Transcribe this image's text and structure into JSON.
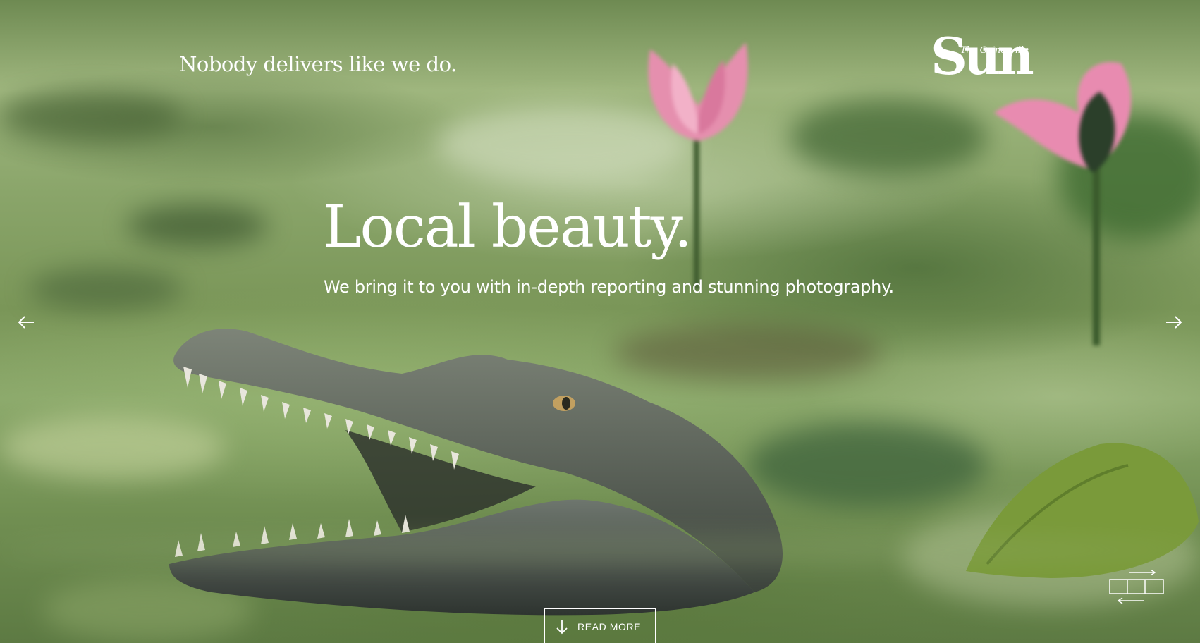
{
  "header": {
    "tagline": "Nobody delivers like we do.",
    "logo": {
      "name": "The Gainesville",
      "wordmark": "Sun"
    }
  },
  "hero": {
    "title": "Local beauty.",
    "subtitle": "We bring it to you with in-depth reporting and stunning photography."
  },
  "controls": {
    "read_more_label": "READ MORE",
    "prev_icon": "arrow-left-icon",
    "next_icon": "arrow-right-icon",
    "layout_icon": "layout-toggle-icon"
  },
  "colors": {
    "text": "#ffffff",
    "foliage": "#7a9658",
    "flower": "#e58fae"
  }
}
